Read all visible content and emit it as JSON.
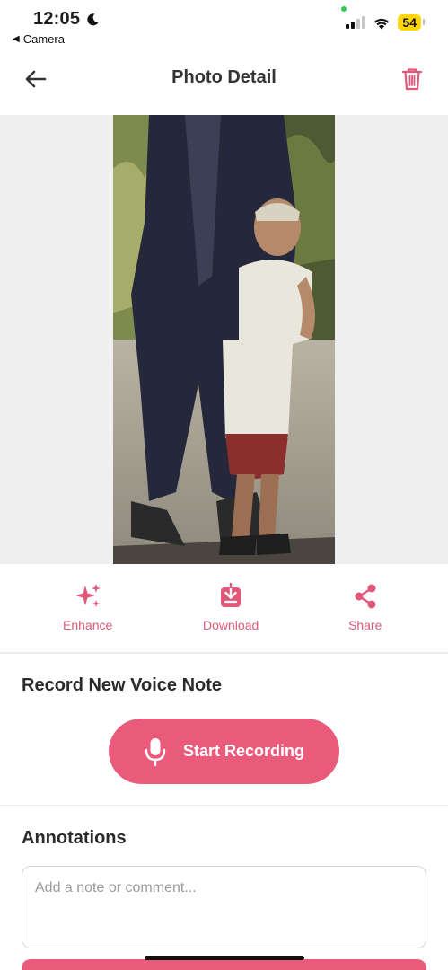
{
  "status_bar": {
    "time": "12:05",
    "back_app": "Camera",
    "battery": "54"
  },
  "header": {
    "title": "Photo Detail"
  },
  "photo": {
    "description_icon": "photo"
  },
  "actions": [
    {
      "label": "Enhance",
      "icon": "sparkles-icon"
    },
    {
      "label": "Download",
      "icon": "download-icon"
    },
    {
      "label": "Share",
      "icon": "share-icon"
    }
  ],
  "voice": {
    "title": "Record New Voice Note",
    "button_label": "Start Recording"
  },
  "annotations": {
    "title": "Annotations",
    "placeholder": "Add a note or comment..."
  },
  "colors": {
    "accent": "#ea5a7b",
    "accent_text": "#e0587a",
    "photo_bg": "#efefef"
  }
}
